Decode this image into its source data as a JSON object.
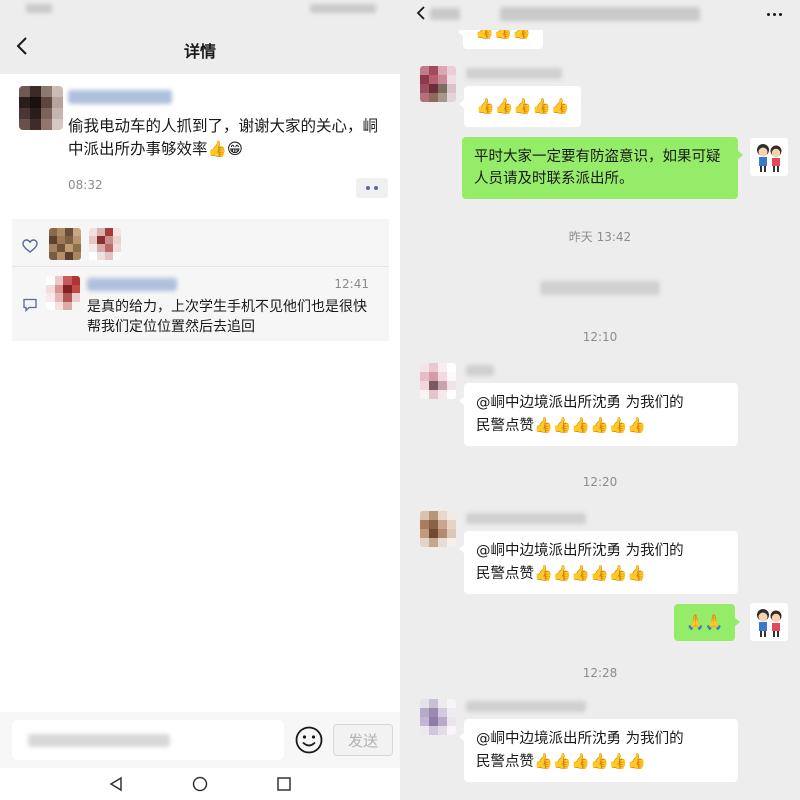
{
  "left": {
    "title": "详情",
    "post": {
      "text": "偷我电动车的人抓到了，谢谢大家的关心，峒中派出所办事够效率👍😁",
      "time": "08:32"
    },
    "comment": {
      "time": "12:41",
      "text": "是真的给力，上次学生手机不见他们也是很快帮我们定位位置然后去追回"
    },
    "input": {
      "send_label": "发送"
    }
  },
  "right": {
    "top_partial_thumbs": "👍👍👍",
    "msg1_thumbs": "👍👍👍👍👍",
    "my_msg": "平时大家一定要有防盗意识，如果可疑人员请及时联系派出所。",
    "ts1": "昨天 13:42",
    "ts2": "12:10",
    "ts3": "12:20",
    "ts4": "12:28",
    "praise_line1": "@峒中边境派出所沈勇  为我们的",
    "praise_line2": "民警点赞",
    "praise_thumbs": "👍👍👍👍👍👍",
    "my_hands": "🙏🙏"
  },
  "icons": {
    "back": "chevron-left-icon",
    "more": "more-dots-icon",
    "like": "heart-icon",
    "comment": "comment-icon",
    "emoji": "smiley-icon",
    "nav_back": "triangle-back-icon",
    "nav_home": "circle-home-icon",
    "nav_recent": "square-recent-icon"
  },
  "colors": {
    "link_blue": "#576b95",
    "my_bubble": "#95ec69",
    "chat_bg": "#ededed"
  }
}
